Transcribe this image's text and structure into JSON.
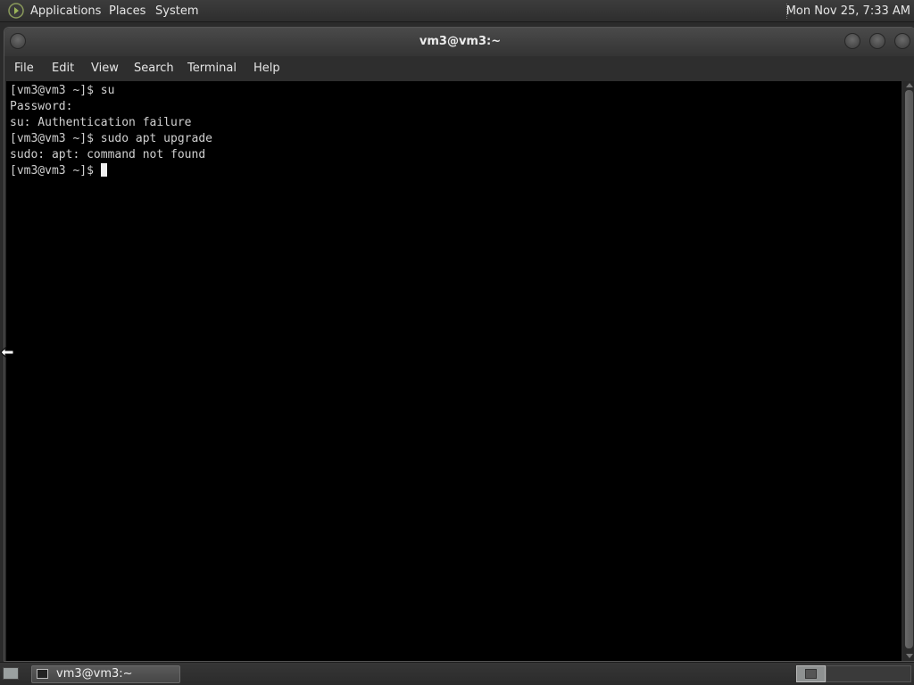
{
  "top_panel": {
    "menus": [
      "Applications",
      "Places",
      "System"
    ],
    "clock": "Mon Nov 25,  7:33 AM"
  },
  "window": {
    "title": "vm3@vm3:~",
    "menubar": [
      "File",
      "Edit",
      "View",
      "Search",
      "Terminal",
      "Help"
    ]
  },
  "terminal": {
    "lines": [
      "[vm3@vm3 ~]$ su",
      "Password:",
      "su: Authentication failure",
      "[vm3@vm3 ~]$ sudo apt upgrade",
      "sudo: apt: command not found",
      "[vm3@vm3 ~]$ "
    ],
    "cursor_color": "#f0f0f0",
    "background": "#000000",
    "foreground": "#d0d0d0"
  },
  "taskbar": {
    "task_label": "vm3@vm3:~"
  },
  "icons": {
    "apps": "gnome-foot-icon",
    "pointer": "resize-horizontal-pointer-icon"
  }
}
